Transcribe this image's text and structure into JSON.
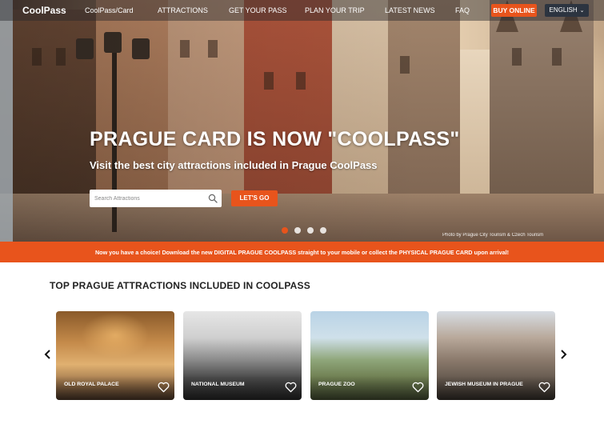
{
  "nav": {
    "logo": "CoolPass",
    "items": [
      "CoolPass/Card",
      "ATTRACTIONS",
      "GET YOUR PASS",
      "PLAN YOUR TRIP",
      "LATEST NEWS",
      "FAQ"
    ],
    "buy_label": "BUY ONLINE",
    "language": "ENGLISH"
  },
  "hero": {
    "title": "PRAGUE CARD IS NOW \"COOLPASS\"",
    "subtitle": "Visit the best city attractions included in Prague CoolPass",
    "search_placeholder": "Search Attractions",
    "go_label": "LET'S GO",
    "slides": 4,
    "active_slide": 1,
    "photo_credit": "Photo by Prague City Tourism & Czech Tourism"
  },
  "banner": {
    "text": "Now you have a choice! Download the new DIGITAL PRAGUE COOLPASS straight to your mobile or collect the PHYSICAL PRAGUE CARD upon arrival!"
  },
  "attractions": {
    "title": "TOP PRAGUE ATTRACTIONS INCLUDED IN COOLPASS",
    "items": [
      {
        "label": "OLD ROYAL PALACE"
      },
      {
        "label": "NATIONAL MUSEUM"
      },
      {
        "label": "PRAGUE ZOO"
      },
      {
        "label": "JEWISH MUSEUM IN PRAGUE"
      }
    ]
  },
  "colors": {
    "accent": "#e8541c",
    "lang_bg": "#2c3440"
  },
  "icons": {
    "search": "search-icon",
    "heart": "heart-icon",
    "prev": "chevron-left-icon",
    "next": "chevron-right-icon",
    "lang_dropdown": "chevron-down-icon"
  }
}
